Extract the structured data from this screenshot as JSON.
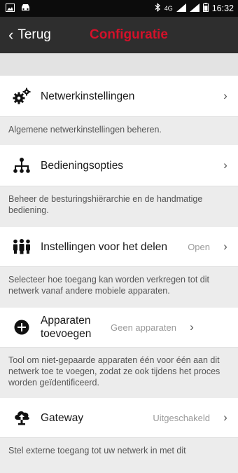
{
  "statusbar": {
    "network": "4G",
    "time": "16:32"
  },
  "topbar": {
    "back_label": "Terug",
    "title": "Configuratie"
  },
  "items": [
    {
      "label": "Netwerkinstellingen",
      "value": "",
      "desc": "Algemene netwerkinstellingen beheren.",
      "icon": "gears-icon"
    },
    {
      "label": "Bedieningsopties",
      "value": "",
      "desc": "Beheer de besturingshiërarchie en de handmatige bediening.",
      "icon": "hierarchy-icon"
    },
    {
      "label": "Instellingen voor het delen",
      "value": "Open",
      "desc": "Selecteer hoe toegang kan worden verkregen tot dit netwerk vanaf andere mobiele apparaten.",
      "icon": "people-share-icon"
    },
    {
      "label": "Apparaten toevoegen",
      "value": "Geen apparaten",
      "desc": "Tool om niet-gepaarde apparaten één voor één aan dit netwerk toe te voegen, zodat ze ook tijdens het proces worden geïdentificeerd.",
      "icon": "add-circle-icon"
    },
    {
      "label": "Gateway",
      "value": "Uitgeschakeld",
      "desc": "Stel externe toegang tot uw netwerk in met dit",
      "icon": "cloud-gateway-icon"
    }
  ]
}
